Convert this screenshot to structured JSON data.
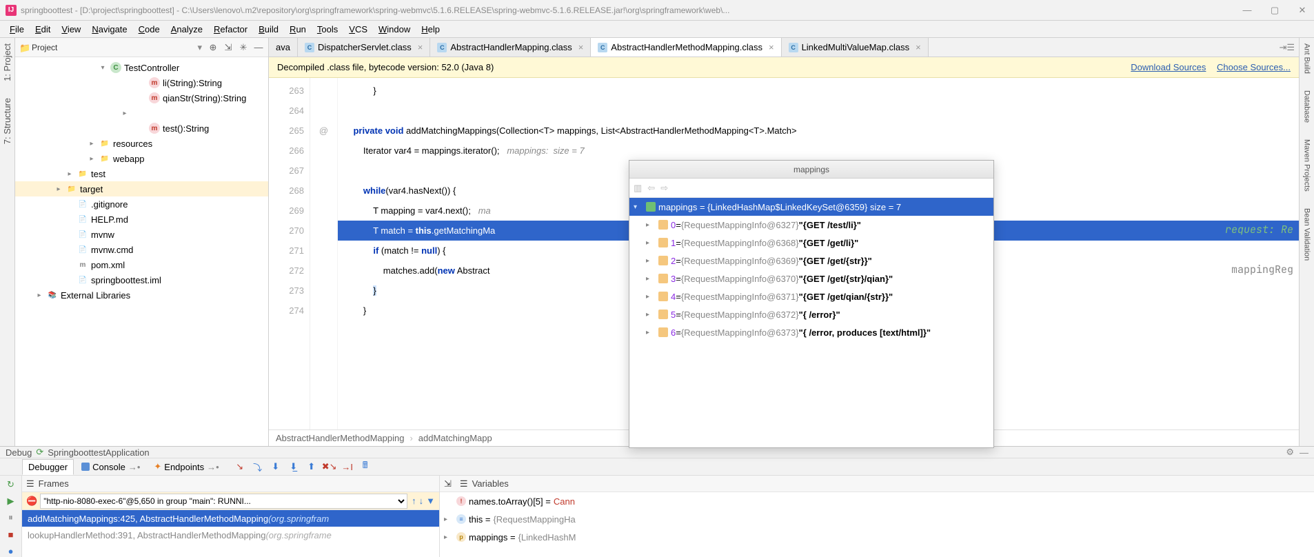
{
  "title_bar": {
    "text": "springboottest - [D:\\project\\springboottest] - C:\\Users\\lenovo\\.m2\\repository\\org\\springframework\\spring-webmvc\\5.1.6.RELEASE\\spring-webmvc-5.1.6.RELEASE.jar!\\org\\springframework\\web\\..."
  },
  "menu": [
    "File",
    "Edit",
    "View",
    "Navigate",
    "Code",
    "Analyze",
    "Refactor",
    "Build",
    "Run",
    "Tools",
    "VCS",
    "Window",
    "Help"
  ],
  "left_tabs": [
    "1: Project",
    "7: Structure"
  ],
  "right_tabs": [
    "Ant Build",
    "Database",
    "Maven Projects",
    "Bean Validation"
  ],
  "project_panel": {
    "header": "Project",
    "tree": [
      {
        "indent": 120,
        "chev": "▾",
        "icon": "cls",
        "iconText": "C",
        "label": "TestController"
      },
      {
        "indent": 176,
        "chev": "",
        "icon": "mth",
        "iconText": "m",
        "label": "li(String):String"
      },
      {
        "indent": 176,
        "chev": "",
        "icon": "mth",
        "iconText": "m",
        "label": "qianStr(String):String"
      },
      {
        "indent": 152,
        "chev": "▸",
        "icon": "",
        "iconText": "",
        "label": ""
      },
      {
        "indent": 176,
        "chev": "",
        "icon": "mth",
        "iconText": "m",
        "label": "test():String"
      },
      {
        "indent": 104,
        "chev": "▸",
        "icon": "dir",
        "iconText": "📁",
        "label": "resources"
      },
      {
        "indent": 104,
        "chev": "▸",
        "icon": "dir",
        "iconText": "📁",
        "label": "webapp"
      },
      {
        "indent": 72,
        "chev": "▸",
        "icon": "dir",
        "iconText": "📁",
        "label": "test"
      },
      {
        "indent": 56,
        "chev": "▸",
        "icon": "tgt",
        "iconText": "📁",
        "label": "target",
        "sel": true
      },
      {
        "indent": 72,
        "chev": "",
        "icon": "dir",
        "iconText": "📄",
        "label": ".gitignore"
      },
      {
        "indent": 72,
        "chev": "",
        "icon": "dir",
        "iconText": "📄",
        "label": "HELP.md"
      },
      {
        "indent": 72,
        "chev": "",
        "icon": "dir",
        "iconText": "📄",
        "label": "mvnw"
      },
      {
        "indent": 72,
        "chev": "",
        "icon": "dir",
        "iconText": "📄",
        "label": "mvnw.cmd"
      },
      {
        "indent": 72,
        "chev": "",
        "icon": "dir",
        "iconText": "m",
        "label": "pom.xml"
      },
      {
        "indent": 72,
        "chev": "",
        "icon": "dir",
        "iconText": "📄",
        "label": "springboottest.iml"
      },
      {
        "indent": 28,
        "chev": "▸",
        "icon": "dir",
        "iconText": "📚",
        "label": "External Libraries"
      }
    ]
  },
  "editor": {
    "tabs": [
      {
        "label": "ava",
        "plain": true
      },
      {
        "label": "DispatcherServlet.class",
        "closable": true
      },
      {
        "label": "AbstractHandlerMapping.class",
        "closable": true
      },
      {
        "label": "AbstractHandlerMethodMapping.class",
        "closable": true,
        "active": true
      },
      {
        "label": "LinkedMultiValueMap.class",
        "closable": true
      }
    ],
    "banner": {
      "text": "Decompiled .class file, bytecode version: 52.0 (Java 8)",
      "link1": "Download Sources",
      "link2": "Choose Sources..."
    },
    "lines": {
      "start": 263,
      "gutter2": {
        "189": "@"
      },
      "code": [
        "            }",
        "",
        "    private void addMatchingMappings(Collection<T> mappings, List<AbstractHandlerMethodMapping<T>.Match>",
        "        Iterator var4 = mappings.iterator();   mappings:  size = 7",
        "",
        "        while(var4.hasNext()) {",
        "            T mapping = var4.next();   ma",
        "            T match = this.getMatchingMa",
        "            if (match != null) {",
        "                matches.add(new Abstract",
        "            }",
        "        }"
      ],
      "overlay_right1": "request: Re",
      "overlay_right2": "mappingReg"
    },
    "breadcrumb": [
      "AbstractHandlerMethodMapping",
      "addMatchingMapp"
    ]
  },
  "popup": {
    "title": "mappings",
    "root": "mappings = {LinkedHashMap$LinkedKeySet@6359}  size = 7",
    "items": [
      {
        "idx": "0",
        "cls": "{RequestMappingInfo@6327}",
        "val": "\"{GET /test/li}\""
      },
      {
        "idx": "1",
        "cls": "{RequestMappingInfo@6368}",
        "val": "\"{GET /get/li}\""
      },
      {
        "idx": "2",
        "cls": "{RequestMappingInfo@6369}",
        "val": "\"{GET /get/{str}}\""
      },
      {
        "idx": "3",
        "cls": "{RequestMappingInfo@6370}",
        "val": "\"{GET /get/{str}/qian}\""
      },
      {
        "idx": "4",
        "cls": "{RequestMappingInfo@6371}",
        "val": "\"{GET /get/qian/{str}}\""
      },
      {
        "idx": "5",
        "cls": "{RequestMappingInfo@6372}",
        "val": "\"{ /error}\""
      },
      {
        "idx": "6",
        "cls": "{RequestMappingInfo@6373}",
        "val": "\"{ /error, produces [text/html]}\""
      }
    ]
  },
  "debug": {
    "header_left": "Debug",
    "header_app": "SpringboottestApplication",
    "tabs": [
      {
        "label": "Debugger",
        "active": true
      },
      {
        "label": "Console"
      },
      {
        "label": "Endpoints"
      }
    ],
    "frames_title": "Frames",
    "thread": "\"http-nio-8080-exec-6\"@5,650 in group \"main\": RUNNI...",
    "frames": [
      {
        "text": "addMatchingMappings:425, AbstractHandlerMethodMapping ",
        "pkg": "(org.springfram",
        "sel": true
      },
      {
        "text": "lookupHandlerMethod:391, AbstractHandlerMethodMapping ",
        "pkg": "(org.springframe",
        "dim": true
      }
    ],
    "vars_title": "Variables",
    "vars": [
      {
        "chev": "",
        "icon": "err",
        "label": "names.toArray()[5] = ",
        "val": "Cann",
        "red": true
      },
      {
        "chev": "▸",
        "icon": "obj",
        "label": "this = ",
        "val": "{RequestMappingHa"
      },
      {
        "chev": "▸",
        "icon": "p",
        "label": "mappings = ",
        "val": "{LinkedHashM"
      }
    ]
  }
}
